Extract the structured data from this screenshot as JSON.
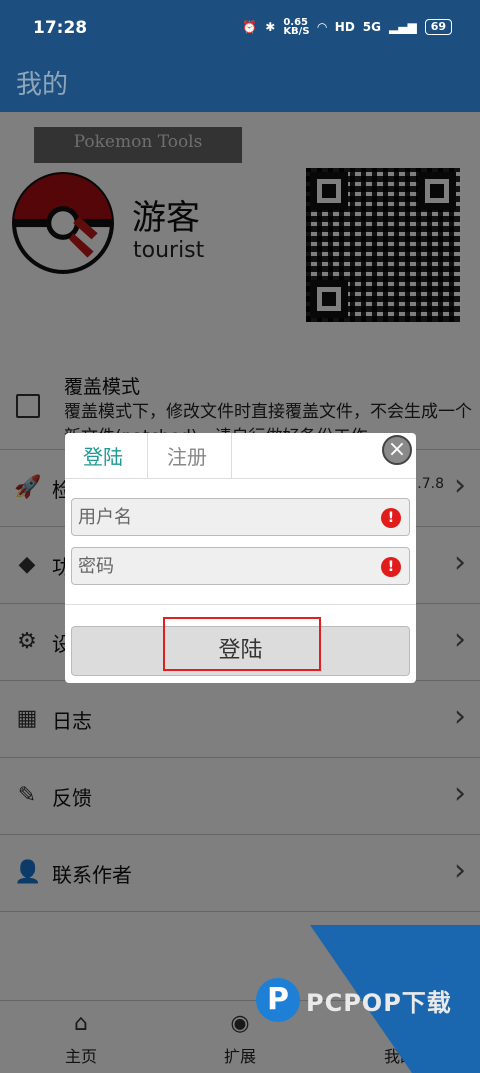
{
  "status": {
    "time": "17:28",
    "speed_top": "0.65",
    "speed_unit": "KB/S",
    "hd": "HD",
    "net": "5G",
    "battery": "69"
  },
  "appbar": {
    "title": "我的"
  },
  "profile": {
    "card_text": "Pokemon Tools",
    "name": "游客",
    "id": "tourist"
  },
  "overwrite": {
    "title": "覆盖模式",
    "desc": "覆盖模式下，修改文件时直接覆盖文件，不会生成一个新文件(patched)，请自行做好备份工作"
  },
  "rows": [
    {
      "icon": "rocket-icon",
      "label": "检",
      "value": "1.7.8"
    },
    {
      "icon": "cube-icon",
      "label": "功",
      "value": ""
    },
    {
      "icon": "gear-icon",
      "label": "设",
      "value": ""
    },
    {
      "icon": "log-icon",
      "label": "日志",
      "value": ""
    },
    {
      "icon": "feather-icon",
      "label": "反馈",
      "value": ""
    },
    {
      "icon": "user-icon",
      "label": "联系作者",
      "value": ""
    }
  ],
  "nav": [
    {
      "icon": "home-icon",
      "label": "主页"
    },
    {
      "icon": "planet-icon",
      "label": "扩展"
    },
    {
      "icon": "profile-icon",
      "label": "我的"
    }
  ],
  "dialog": {
    "tab_login": "登陆",
    "tab_register": "注册",
    "username_placeholder": "用户名",
    "password_placeholder": "密码",
    "warn_mark": "!",
    "login_button": "登陆",
    "close_mark": "×"
  },
  "brand": {
    "mark": "P",
    "text": "PCPOP下载"
  },
  "colors": {
    "appbar": "#1c4f7f",
    "accent": "#1f9a93",
    "warn": "#e21b1b",
    "highlight": "#e02020"
  }
}
